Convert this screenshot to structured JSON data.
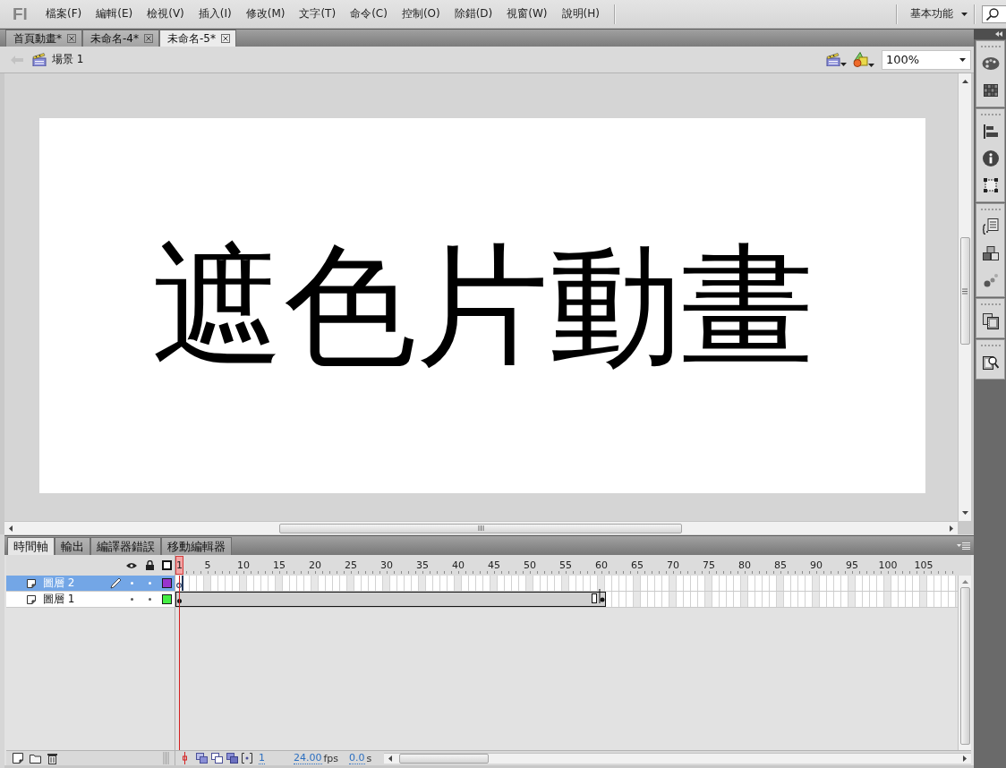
{
  "app": {
    "logo": "Fl"
  },
  "menu": [
    "檔案(F)",
    "編輯(E)",
    "檢視(V)",
    "插入(I)",
    "修改(M)",
    "文字(T)",
    "命令(C)",
    "控制(O)",
    "除錯(D)",
    "視窗(W)",
    "說明(H)"
  ],
  "workspace": {
    "label": "基本功能"
  },
  "document_tabs": [
    {
      "label": "首頁動畫*",
      "selected": false
    },
    {
      "label": "未命名-4*",
      "selected": false
    },
    {
      "label": "未命名-5*",
      "selected": true
    }
  ],
  "scene_bar": {
    "scene": "場景 1",
    "zoom": "100%"
  },
  "stage": {
    "text": "遮色片動畫"
  },
  "panel_tabs": [
    {
      "label": "時間軸",
      "selected": true
    },
    {
      "label": "輸出",
      "selected": false
    },
    {
      "label": "編譯器錯誤",
      "selected": false
    },
    {
      "label": "移動編輯器",
      "selected": false
    }
  ],
  "timeline": {
    "frame_numbers": [
      {
        "label": "1",
        "selected": true
      },
      {
        "label": "5",
        "selected": false
      },
      {
        "label": "10",
        "selected": false
      },
      {
        "label": "15",
        "selected": false
      },
      {
        "label": "20",
        "selected": false
      },
      {
        "label": "25",
        "selected": false
      },
      {
        "label": "30",
        "selected": false
      },
      {
        "label": "35",
        "selected": false
      },
      {
        "label": "40",
        "selected": false
      },
      {
        "label": "45",
        "selected": false
      },
      {
        "label": "50",
        "selected": false
      },
      {
        "label": "55",
        "selected": false
      },
      {
        "label": "60",
        "selected": false
      },
      {
        "label": "65",
        "selected": false
      },
      {
        "label": "70",
        "selected": false
      },
      {
        "label": "75",
        "selected": false
      },
      {
        "label": "80",
        "selected": false
      },
      {
        "label": "85",
        "selected": false
      },
      {
        "label": "90",
        "selected": false
      },
      {
        "label": "95",
        "selected": false
      },
      {
        "label": "100",
        "selected": false
      },
      {
        "label": "105",
        "selected": false
      }
    ],
    "layers": [
      {
        "name": "圖層 2",
        "selected": true,
        "editing": true,
        "color": "#9933cc",
        "kind": "empty-keyframe"
      },
      {
        "name": "圖層 1",
        "selected": false,
        "editing": false,
        "color": "#44ee44",
        "kind": "tween",
        "level": 0.55
      }
    ],
    "current_frame": "1",
    "frame_rate": "24.00",
    "frame_rate_unit": "fps",
    "elapsed": "0.0",
    "elapsed_unit": "s"
  }
}
